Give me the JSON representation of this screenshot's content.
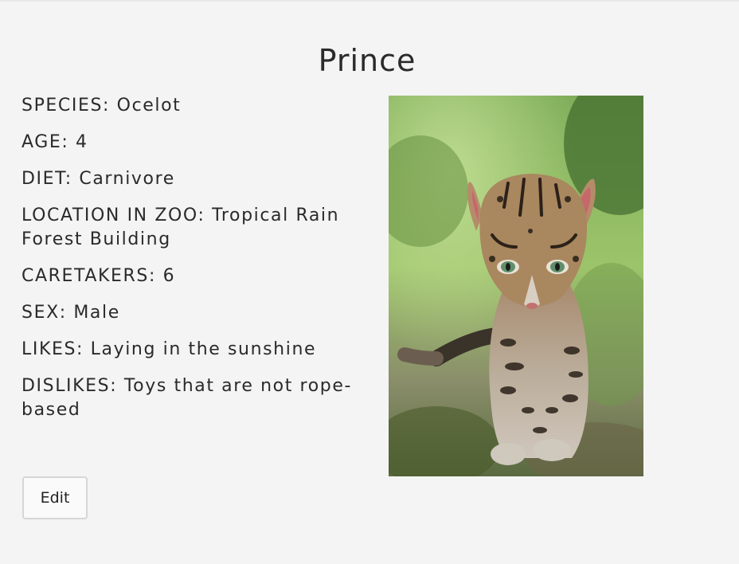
{
  "animal": {
    "name": "Prince",
    "fields": [
      {
        "label": "SPECIES:",
        "value": "Ocelot"
      },
      {
        "label": "AGE:",
        "value": "4"
      },
      {
        "label": "DIET:",
        "value": "Carnivore"
      },
      {
        "label": "LOCATION IN ZOO:",
        "value": "Tropical Rain Forest Building"
      },
      {
        "label": "CARETAKERS:",
        "value": "6"
      },
      {
        "label": "SEX:",
        "value": "Male"
      },
      {
        "label": "LIKES:",
        "value": "Laying in the sunshine"
      },
      {
        "label": "DISLIKES:",
        "value": "Toys that are not rope-based"
      }
    ]
  },
  "actions": {
    "edit_label": "Edit"
  }
}
